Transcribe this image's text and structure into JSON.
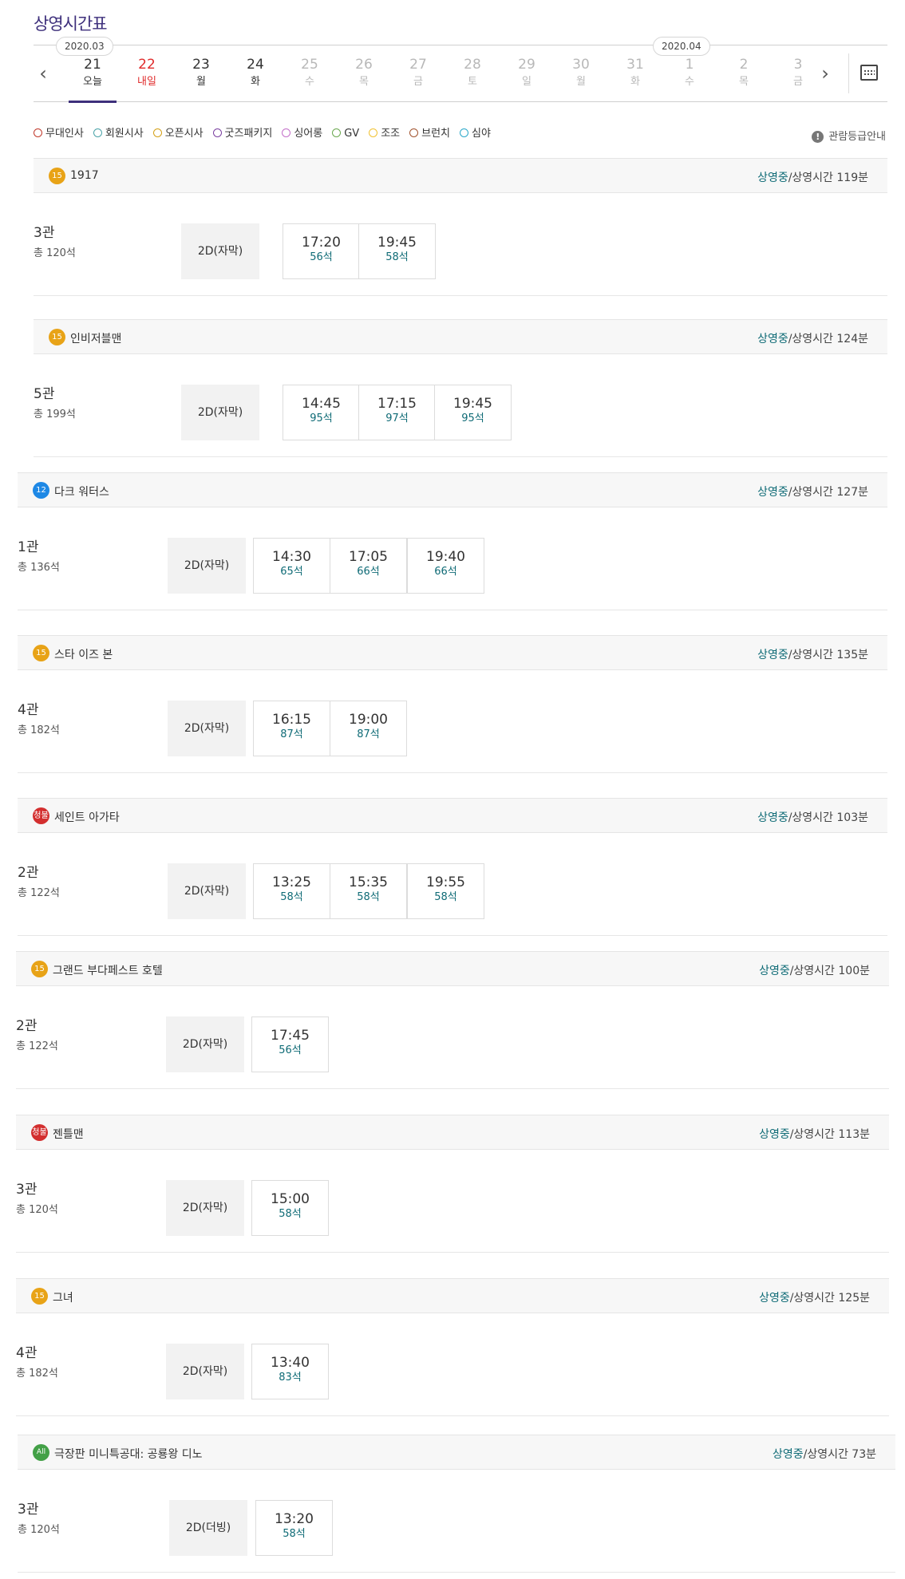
{
  "page_title": "상영시간표",
  "months": [
    "2020.03",
    "2020.04"
  ],
  "dates": [
    {
      "num": "21",
      "dow": "오늘",
      "state": "active"
    },
    {
      "num": "22",
      "dow": "내일",
      "state": "sat-red"
    },
    {
      "num": "23",
      "dow": "월",
      "state": "normal"
    },
    {
      "num": "24",
      "dow": "화",
      "state": "normal"
    },
    {
      "num": "25",
      "dow": "수",
      "state": "disabled"
    },
    {
      "num": "26",
      "dow": "목",
      "state": "disabled"
    },
    {
      "num": "27",
      "dow": "금",
      "state": "disabled"
    },
    {
      "num": "28",
      "dow": "토",
      "state": "disabled"
    },
    {
      "num": "29",
      "dow": "일",
      "state": "disabled"
    },
    {
      "num": "30",
      "dow": "월",
      "state": "disabled"
    },
    {
      "num": "31",
      "dow": "화",
      "state": "disabled"
    },
    {
      "num": "1",
      "dow": "수",
      "state": "disabled"
    },
    {
      "num": "2",
      "dow": "목",
      "state": "disabled"
    },
    {
      "num": "3",
      "dow": "금",
      "state": "disabled"
    }
  ],
  "legend": [
    {
      "label": "무대인사",
      "color": "#c0392b",
      "icon": "stage-greeting-icon"
    },
    {
      "label": "회원시사",
      "color": "#4aa3a8",
      "icon": "member-preview-icon"
    },
    {
      "label": "오픈시사",
      "color": "#d4a017",
      "icon": "open-preview-icon"
    },
    {
      "label": "굿즈패키지",
      "color": "#7a3fa0",
      "icon": "goods-package-icon"
    },
    {
      "label": "싱어롱",
      "color": "#c36fc9",
      "icon": "singalong-icon"
    },
    {
      "label": "GV",
      "color": "#6aa84f",
      "icon": "gv-icon"
    },
    {
      "label": "조조",
      "color": "#f1c232",
      "icon": "morning-sun-icon"
    },
    {
      "label": "브런치",
      "color": "#a0522d",
      "icon": "brunch-cup-icon"
    },
    {
      "label": "심야",
      "color": "#2aa7c9",
      "icon": "late-night-moon-icon"
    }
  ],
  "rating_guide": "관람등급안내",
  "rating_guide_glyph": "!",
  "status_on": "상영중",
  "runtime_prefix": "/상영시간 ",
  "movies": [
    {
      "rating": "15",
      "rating_color": "#e8a317",
      "title": "1917",
      "runtime": "119분",
      "hall": "3관",
      "seats": "총 120석",
      "format": "2D(자막)",
      "times": [
        {
          "t": "17:20",
          "s": "56석"
        },
        {
          "t": "19:45",
          "s": "58석"
        }
      ]
    },
    {
      "rating": "15",
      "rating_color": "#e8a317",
      "title": "인비저블맨",
      "runtime": "124분",
      "hall": "5관",
      "seats": "총 199석",
      "format": "2D(자막)",
      "times": [
        {
          "t": "14:45",
          "s": "95석"
        },
        {
          "t": "17:15",
          "s": "97석"
        },
        {
          "t": "19:45",
          "s": "95석"
        }
      ]
    },
    {
      "rating": "12",
      "rating_color": "#1e88e5",
      "title": "다크 워터스",
      "runtime": "127분",
      "hall": "1관",
      "seats": "총 136석",
      "format": "2D(자막)",
      "times": [
        {
          "t": "14:30",
          "s": "65석"
        },
        {
          "t": "17:05",
          "s": "66석"
        },
        {
          "t": "19:40",
          "s": "66석"
        }
      ]
    },
    {
      "rating": "15",
      "rating_color": "#e8a317",
      "title": "스타 이즈 본",
      "runtime": "135분",
      "hall": "4관",
      "seats": "총 182석",
      "format": "2D(자막)",
      "times": [
        {
          "t": "16:15",
          "s": "87석"
        },
        {
          "t": "19:00",
          "s": "87석"
        }
      ]
    },
    {
      "rating": "청불",
      "rating_color": "#d32f2f",
      "title": "세인트 아가타",
      "runtime": "103분",
      "hall": "2관",
      "seats": "총 122석",
      "format": "2D(자막)",
      "times": [
        {
          "t": "13:25",
          "s": "58석"
        },
        {
          "t": "15:35",
          "s": "58석"
        },
        {
          "t": "19:55",
          "s": "58석"
        }
      ]
    },
    {
      "rating": "15",
      "rating_color": "#e8a317",
      "title": "그랜드 부다페스트 호텔",
      "runtime": "100분",
      "hall": "2관",
      "seats": "총 122석",
      "format": "2D(자막)",
      "times": [
        {
          "t": "17:45",
          "s": "56석"
        }
      ]
    },
    {
      "rating": "청불",
      "rating_color": "#d32f2f",
      "title": "젠틀맨",
      "runtime": "113분",
      "hall": "3관",
      "seats": "총 120석",
      "format": "2D(자막)",
      "times": [
        {
          "t": "15:00",
          "s": "58석"
        }
      ]
    },
    {
      "rating": "15",
      "rating_color": "#e8a317",
      "title": "그녀",
      "runtime": "125분",
      "hall": "4관",
      "seats": "총 182석",
      "format": "2D(자막)",
      "times": [
        {
          "t": "13:40",
          "s": "83석"
        }
      ]
    },
    {
      "rating": "All",
      "rating_color": "#43a047",
      "title": "극장판 미니특공대: 공룡왕 디노",
      "runtime": "73분",
      "hall": "3관",
      "seats": "총 120석",
      "format": "2D(더빙)",
      "times": [
        {
          "t": "13:20",
          "s": "58석"
        }
      ]
    }
  ]
}
